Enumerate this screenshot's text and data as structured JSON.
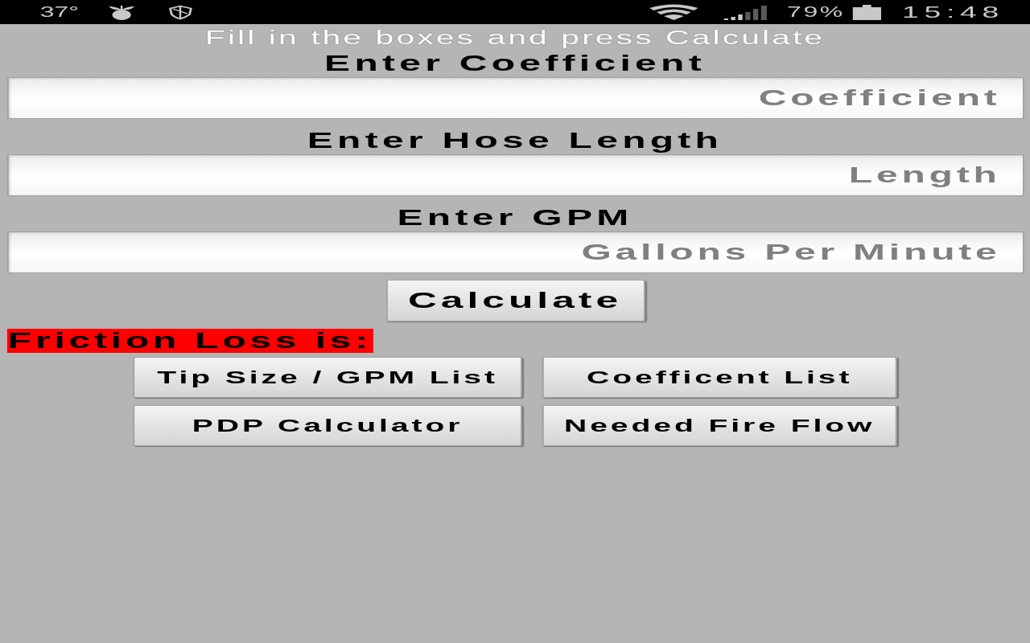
{
  "status_bar": {
    "temperature": "37°",
    "battery": "79%",
    "time": "15:48"
  },
  "instructions": "Fill in the boxes and press Calculate",
  "fields": [
    {
      "label": "Enter Coefficient",
      "placeholder": "Coefficient"
    },
    {
      "label": "Enter Hose Length",
      "placeholder": "Length"
    },
    {
      "label": "Enter GPM",
      "placeholder": "Gallons Per Minute"
    }
  ],
  "calculate_button": "Calculate",
  "result_label": "Friction Loss is:",
  "buttons": [
    "Tip Size / GPM List",
    "Coefficent List",
    "PDP Calculator",
    "Needed Fire Flow"
  ]
}
